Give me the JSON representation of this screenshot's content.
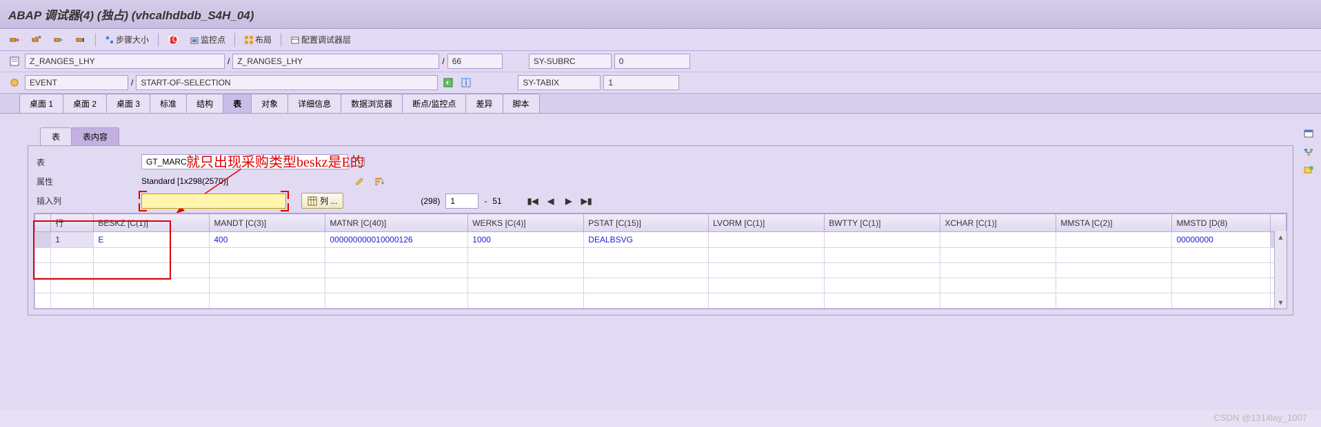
{
  "title": "ABAP 调试器(4)  (独占) (vhcalhdbdb_S4H_04)",
  "toolbar": {
    "step_size": "步骤大小",
    "watchpoint": "监控点",
    "layout": "布局",
    "config": "配置调试器层"
  },
  "info": {
    "prog1": "Z_RANGES_LHY",
    "prog2": "Z_RANGES_LHY",
    "line": "66",
    "subrc_label": "SY-SUBRC",
    "subrc_val": "0",
    "event_label": "EVENT",
    "event_val": "START-OF-SELECTION",
    "tabix_label": "SY-TABIX",
    "tabix_val": "1",
    "slash": "/"
  },
  "main_tabs": [
    "桌面 1",
    "桌面 2",
    "桌面 3",
    "标准",
    "结构",
    "表",
    "对象",
    "详细信息",
    "数据浏览器",
    "断点/监控点",
    "差异",
    "脚本"
  ],
  "main_active": 5,
  "sub_tabs": [
    "表",
    "表内容"
  ],
  "sub_active": 1,
  "annotation": "就只出现采购类型beskz是E的",
  "form": {
    "table_label": "表",
    "table_value": "GT_MARC",
    "attr_label": "属性",
    "attr_value": "Standard [1x298(2570)]",
    "insert_label": "插入列",
    "col_btn": "列 ..."
  },
  "pager": {
    "total": "(298)",
    "from": "1",
    "dash": "-",
    "to": "51"
  },
  "grid": {
    "columns": [
      "行",
      "BESKZ [C(1)]",
      "MANDT [C(3)]",
      "MATNR [C(40)]",
      "WERKS [C(4)]",
      "PSTAT [C(15)]",
      "LVORM [C(1)]",
      "BWTTY [C(1)]",
      "XCHAR [C(1)]",
      "MMSTA [C(2)]",
      "MMSTD [D(8)"
    ],
    "rows": [
      {
        "n": "1",
        "beskz": "E",
        "mandt": "400",
        "matnr": "000000000010000126",
        "werks": "1000",
        "pstat": "DEALBSVG",
        "lvorm": "",
        "bwtty": "",
        "xchar": "",
        "mmsta": "",
        "mmstd": "00000000"
      }
    ]
  },
  "watermark": "CSDN @1314lay_1007"
}
